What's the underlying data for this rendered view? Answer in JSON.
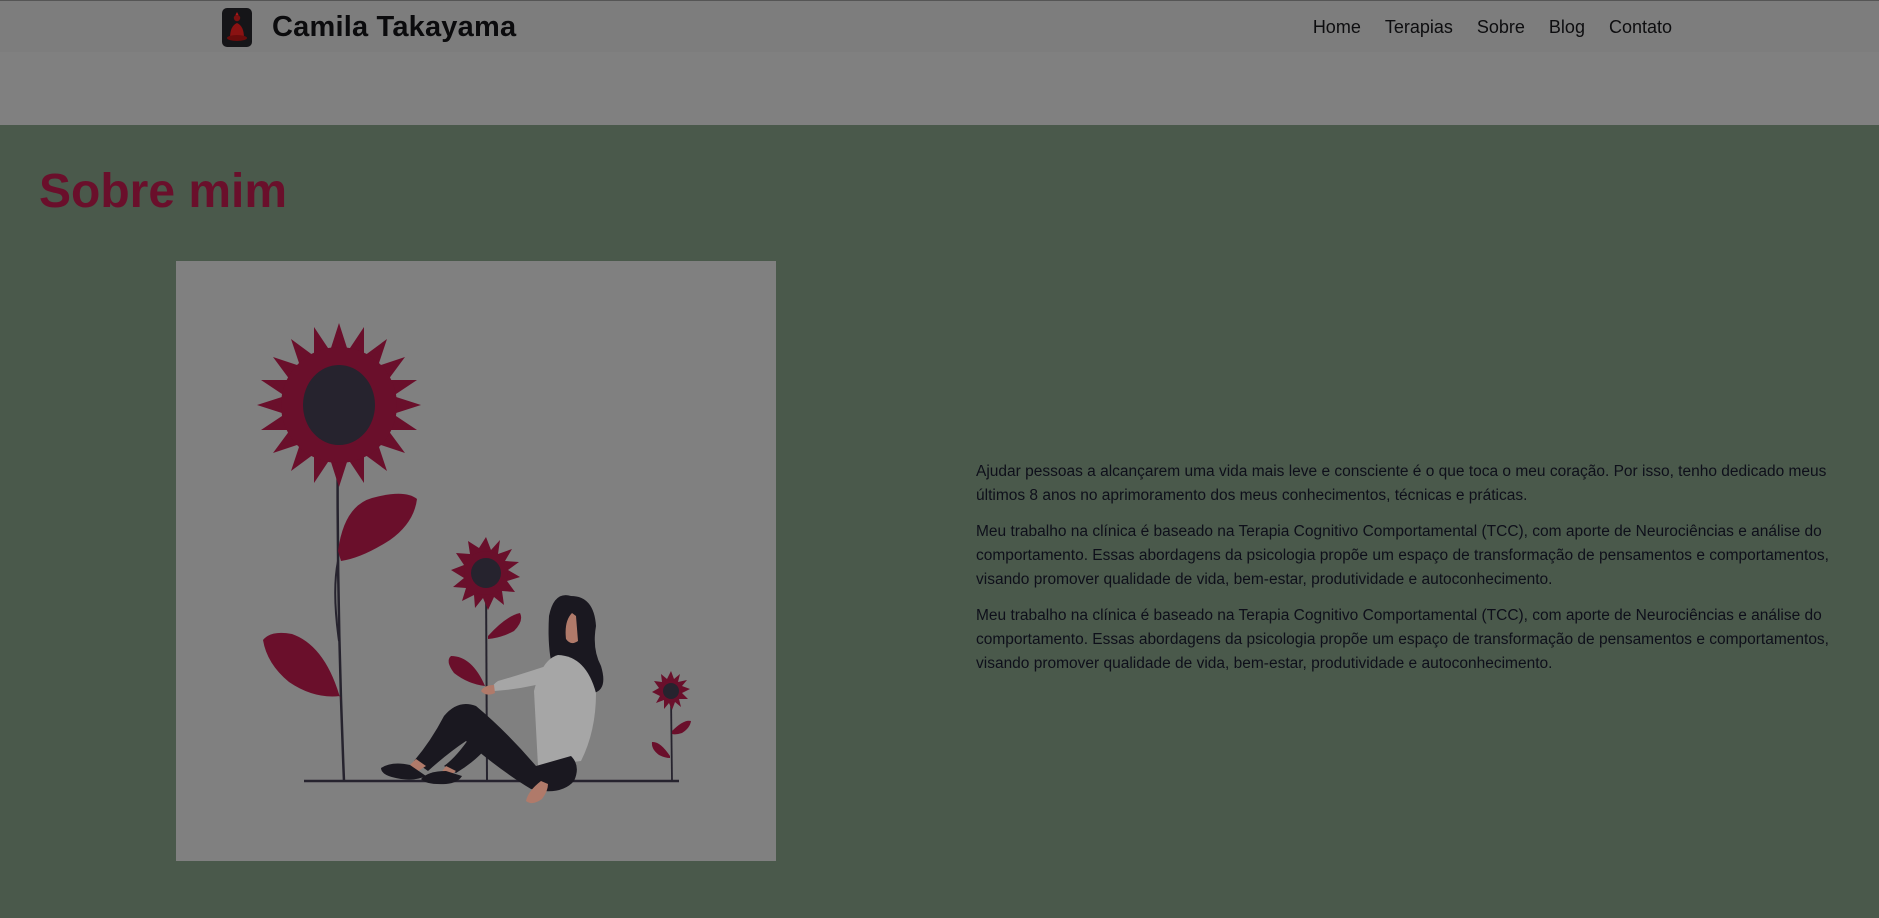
{
  "header": {
    "brand": "Camila Takayama",
    "logo_icon": "buddha-logo-icon",
    "nav": [
      {
        "label": "Home"
      },
      {
        "label": "Terapias"
      },
      {
        "label": "Sobre"
      },
      {
        "label": "Blog"
      },
      {
        "label": "Contato"
      }
    ]
  },
  "about": {
    "title": "Sobre mim",
    "illustration_icon": "woman-with-sunflowers-illustration",
    "paragraphs": [
      "Ajudar pessoas a alcançarem uma vida mais leve e consciente é o que toca o meu coração. Por isso, tenho dedicado meus últimos 8 anos no aprimoramento dos meus conhecimentos, técnicas e práticas.",
      "Meu trabalho na clínica é baseado na Terapia Cognitivo Comportamental (TCC), com aporte de Neurociências e análise do comportamento. Essas abordagens da psicologia propõe um espaço de transformação de pensamentos e comportamentos, visando promover qualidade de vida, bem-estar, produtividade e autoconhecimento.",
      "Meu trabalho na clínica é baseado na Terapia Cognitivo Comportamental (TCC), com aporte de Neurociências e análise do comportamento. Essas abordagens da psicologia propõe um espaço de transformação de pensamentos e comportamentos, visando promover qualidade de vida, bem-estar, produtividade e autoconhecimento."
    ]
  },
  "colors": {
    "page_background": "#4a594b",
    "header_background": "#7d7d7d",
    "accent": "#6a0f2b",
    "flower_center": "#26232e",
    "illustration_background": "#808080"
  }
}
